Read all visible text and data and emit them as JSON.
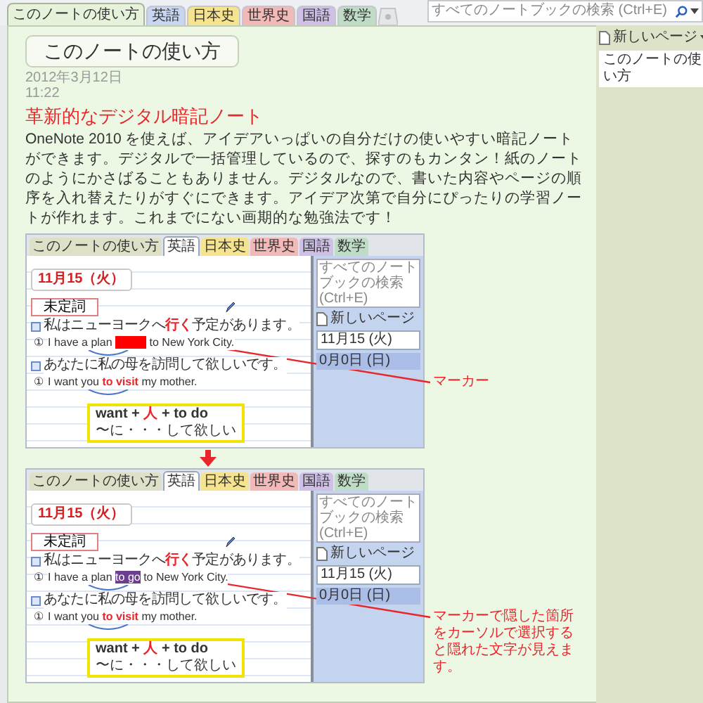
{
  "tabs": [
    {
      "label": "このノートの使い方",
      "color": "#e6f2d9",
      "selected": true
    },
    {
      "label": "英語",
      "color": "#c9d6f2",
      "selected": false
    },
    {
      "label": "日本史",
      "color": "#f5e38f",
      "selected": false
    },
    {
      "label": "世界史",
      "color": "#f2b9b9",
      "selected": false
    },
    {
      "label": "国語",
      "color": "#cfc0e8",
      "selected": false
    },
    {
      "label": "数学",
      "color": "#bfdcc7",
      "selected": false
    }
  ],
  "search": {
    "placeholder": "すべてのノートブックの検索 (Ctrl+E)"
  },
  "page": {
    "title": "このノートの使い方",
    "date": "2012年3月12日",
    "time": "11:22",
    "heading": "革新的なデジタル暗記ノート",
    "paragraph": "OneNote 2010 を使えば、アイデアいっぱいの自分だけの使いやすい暗記ノートができます。デジタルで一括管理しているので、探すのもカンタン！紙のノートのようにかさばることもありません。デジタルなので、書いた内容やページの順序を入れ替えたりがすぐにできます。アイデア次第で自分にぴったりの学習ノートが作れます。これまでにない画期的な勉強法です！",
    "figures": [
      {
        "screenshot": {
          "tabs": [
            {
              "label": "このノートの使い方",
              "color": "#dfe0c8",
              "selected": false
            },
            {
              "label": "英語",
              "color": "#ffffff",
              "selected": true
            },
            {
              "label": "日本史",
              "color": "#f5e38f",
              "selected": false
            },
            {
              "label": "世界史",
              "color": "#f2b9b9",
              "selected": false
            },
            {
              "label": "国語",
              "color": "#cfc0e8",
              "selected": false
            },
            {
              "label": "数学",
              "color": "#bfdcc7",
              "selected": false
            }
          ],
          "search": {
            "placeholder": "すべてのノートブックの検索 (Ctrl+E)"
          },
          "title": "11月15（火）",
          "label": "未定詞",
          "rows": [
            {
              "japanese": [
                {
                  "kind": "text",
                  "text": "私はニューヨークへ",
                  "emphasis": false
                },
                {
                  "kind": "text",
                  "text": "行く",
                  "emphasis": true
                },
                {
                  "kind": "text",
                  "text": "予定があります。",
                  "emphasis": false
                }
              ],
              "number": "①",
              "english": [
                {
                  "kind": "text",
                  "text": "I have a plan ",
                  "emphasis": false
                },
                {
                  "kind": "marker",
                  "revealed": false
                },
                {
                  "kind": "text",
                  "text": " to New York City.",
                  "emphasis": false
                }
              ]
            },
            {
              "japanese": [
                {
                  "kind": "text",
                  "text": "あなたに私の母を訪問して欲しいです。",
                  "emphasis": false
                }
              ],
              "number": "①",
              "english": [
                {
                  "kind": "text",
                  "text": "I want you ",
                  "emphasis": false
                },
                {
                  "kind": "text",
                  "text": "to visit",
                  "emphasis": true
                },
                {
                  "kind": "text",
                  "text": " my mother.",
                  "emphasis": false
                }
              ]
            }
          ],
          "note": {
            "formula": [
              {
                "kind": "text",
                "text": "want + ",
                "emphasis": false
              },
              {
                "kind": "text",
                "text": "人",
                "emphasis": true
              },
              {
                "kind": "text",
                "text": " + to do",
                "emphasis": false
              }
            ],
            "meaning": "〜に・・・して欲しい"
          },
          "new_page": "新しいページ",
          "pages": [
            {
              "title": "11月15 (火)",
              "selected": true
            },
            {
              "title": "0月0日 (日)",
              "selected": false
            }
          ]
        },
        "callout": "マーカー"
      },
      {
        "screenshot": {
          "tabs": [
            {
              "label": "このノートの使い方",
              "color": "#dfe0c8",
              "selected": false
            },
            {
              "label": "英語",
              "color": "#ffffff",
              "selected": true
            },
            {
              "label": "日本史",
              "color": "#f5e38f",
              "selected": false
            },
            {
              "label": "世界史",
              "color": "#f2b9b9",
              "selected": false
            },
            {
              "label": "国語",
              "color": "#cfc0e8",
              "selected": false
            },
            {
              "label": "数学",
              "color": "#bfdcc7",
              "selected": false
            }
          ],
          "search": {
            "placeholder": "すべてのノートブックの検索 (Ctrl+E)"
          },
          "title": "11月15（火）",
          "label": "未定詞",
          "rows": [
            {
              "japanese": [
                {
                  "kind": "text",
                  "text": "私はニューヨークへ",
                  "emphasis": false
                },
                {
                  "kind": "text",
                  "text": "行く",
                  "emphasis": true
                },
                {
                  "kind": "text",
                  "text": "予定があります。",
                  "emphasis": false
                }
              ],
              "number": "①",
              "english": [
                {
                  "kind": "text",
                  "text": "I have a plan ",
                  "emphasis": false
                },
                {
                  "kind": "marker",
                  "revealed": true,
                  "text": "to go"
                },
                {
                  "kind": "text",
                  "text": " to New York City.",
                  "emphasis": false
                }
              ]
            },
            {
              "japanese": [
                {
                  "kind": "text",
                  "text": "あなたに私の母を訪問して欲しいです。",
                  "emphasis": false
                }
              ],
              "number": "①",
              "english": [
                {
                  "kind": "text",
                  "text": "I want you ",
                  "emphasis": false
                },
                {
                  "kind": "text",
                  "text": "to visit",
                  "emphasis": true
                },
                {
                  "kind": "text",
                  "text": " my mother.",
                  "emphasis": false
                }
              ]
            }
          ],
          "note": {
            "formula": [
              {
                "kind": "text",
                "text": "want + ",
                "emphasis": false
              },
              {
                "kind": "text",
                "text": "人",
                "emphasis": true
              },
              {
                "kind": "text",
                "text": " + to do",
                "emphasis": false
              }
            ],
            "meaning": "〜に・・・して欲しい"
          },
          "new_page": "新しいページ",
          "pages": [
            {
              "title": "11月15 (火)",
              "selected": true
            },
            {
              "title": "0月0日 (日)",
              "selected": false
            }
          ]
        },
        "callout": "マーカーで隠した箇所をカーソルで選択すると隠れた文字が見えます。"
      }
    ]
  },
  "sidebar": {
    "new_page": "新しいページ",
    "pages": [
      {
        "title": "このノートの使い方",
        "selected": true
      }
    ]
  }
}
